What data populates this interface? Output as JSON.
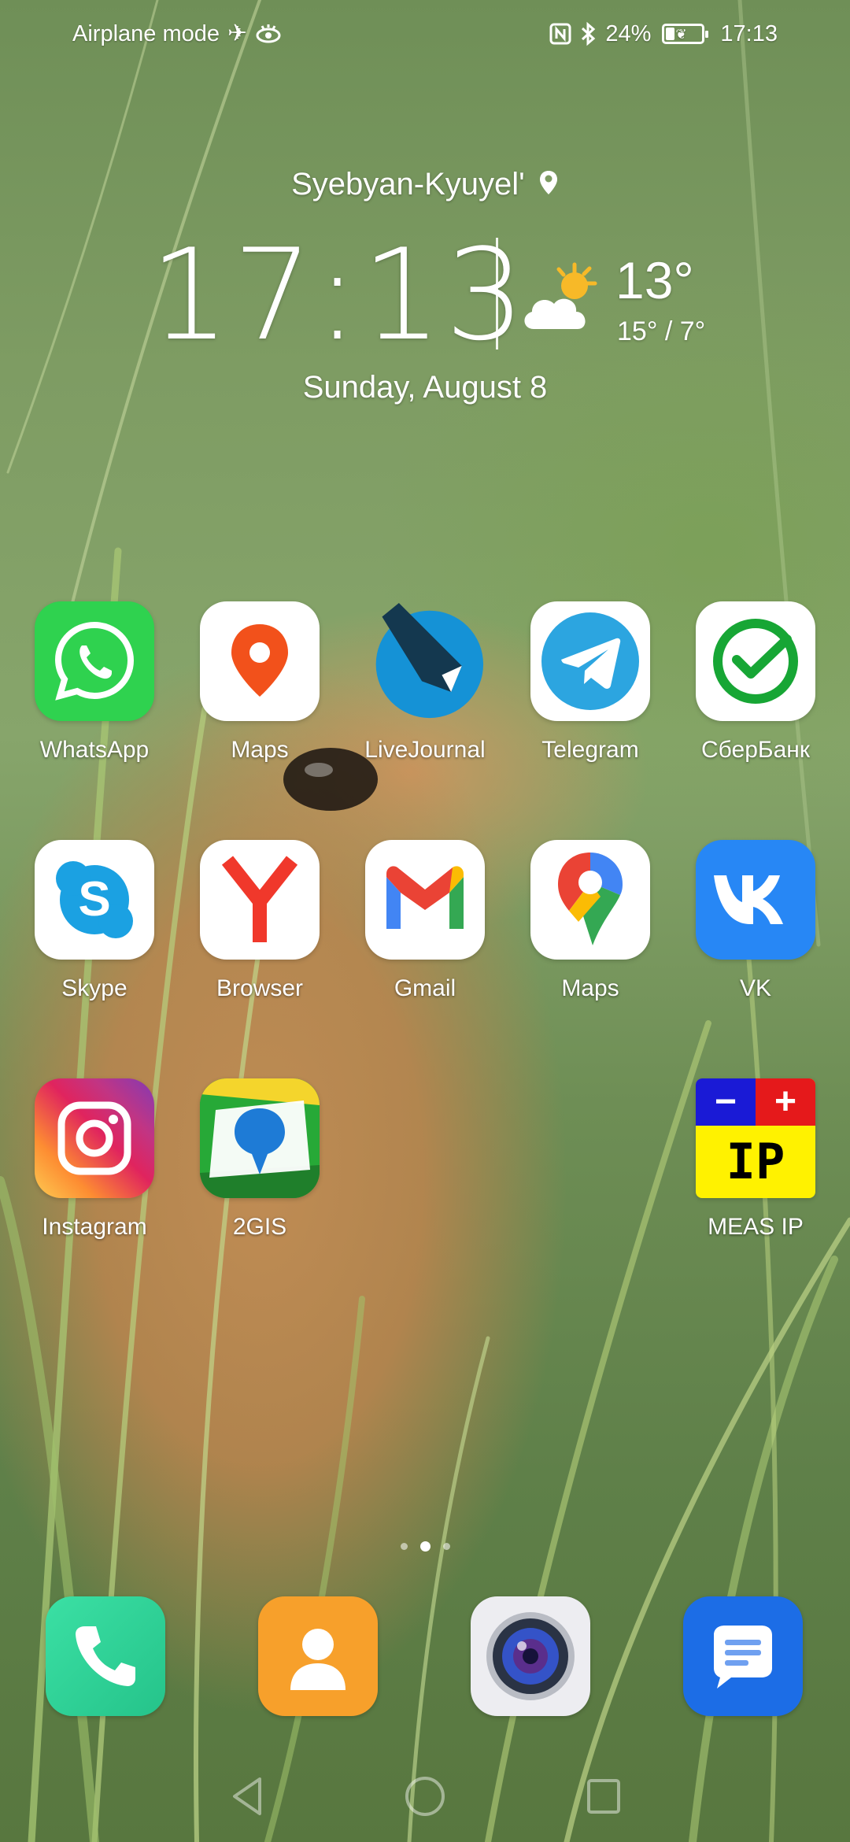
{
  "status_bar": {
    "left_text": "Airplane mode",
    "airplane_icon": "airplane-icon",
    "eye_icon": "eye-comfort-icon",
    "nfc_icon": "nfc-icon",
    "bluetooth_icon": "bluetooth-icon",
    "battery_percent": "24%",
    "battery_level": 0.24,
    "time": "17:13"
  },
  "widget": {
    "location": "Syebyan-Kyuyel'",
    "location_icon": "location-pin-icon",
    "clock": "17:13",
    "temperature": "13°",
    "temp_range": "15° / 7°",
    "weather_icon": "partly-cloudy-icon",
    "date": "Sunday, August 8"
  },
  "apps": [
    {
      "label": "WhatsApp",
      "icon": "whatsapp-icon"
    },
    {
      "label": "Maps",
      "icon": "maps-pin-icon"
    },
    {
      "label": "LiveJournal",
      "icon": "livejournal-icon"
    },
    {
      "label": "Telegram",
      "icon": "telegram-icon"
    },
    {
      "label": "СберБанк",
      "icon": "sberbank-icon"
    },
    {
      "label": "Skype",
      "icon": "skype-icon"
    },
    {
      "label": "Browser",
      "icon": "yandex-browser-icon"
    },
    {
      "label": "Gmail",
      "icon": "gmail-icon"
    },
    {
      "label": "Maps",
      "icon": "google-maps-icon"
    },
    {
      "label": "VK",
      "icon": "vk-icon"
    },
    {
      "label": "Instagram",
      "icon": "instagram-icon"
    },
    {
      "label": "2GIS",
      "icon": "2gis-icon"
    },
    {
      "label": "MEAS IP",
      "icon": "meas-ip-icon",
      "icon_minus": "−",
      "icon_plus": "+",
      "icon_text": "IP"
    }
  ],
  "page_indicator": {
    "pages": 3,
    "current": 2
  },
  "dock": [
    {
      "name": "phone",
      "icon": "phone-icon"
    },
    {
      "name": "contacts",
      "icon": "contacts-icon"
    },
    {
      "name": "camera",
      "icon": "camera-icon"
    },
    {
      "name": "messages",
      "icon": "messages-icon"
    }
  ],
  "nav_bar": {
    "back": "back-icon",
    "home": "home-icon",
    "recents": "recents-icon"
  },
  "colors": {
    "whatsapp": "#2FD24F",
    "maps_red": "#F2511B",
    "livejournal": "#1592D6",
    "telegram": "#2CA5E0",
    "sber": "#17A635",
    "skype": "#1BA1E2",
    "yandex_red": "#F0382B",
    "vk": "#2787F5",
    "phone_green": "#33D29A",
    "contacts_orange": "#F7A02B",
    "messages_blue": "#1C6DE6"
  }
}
